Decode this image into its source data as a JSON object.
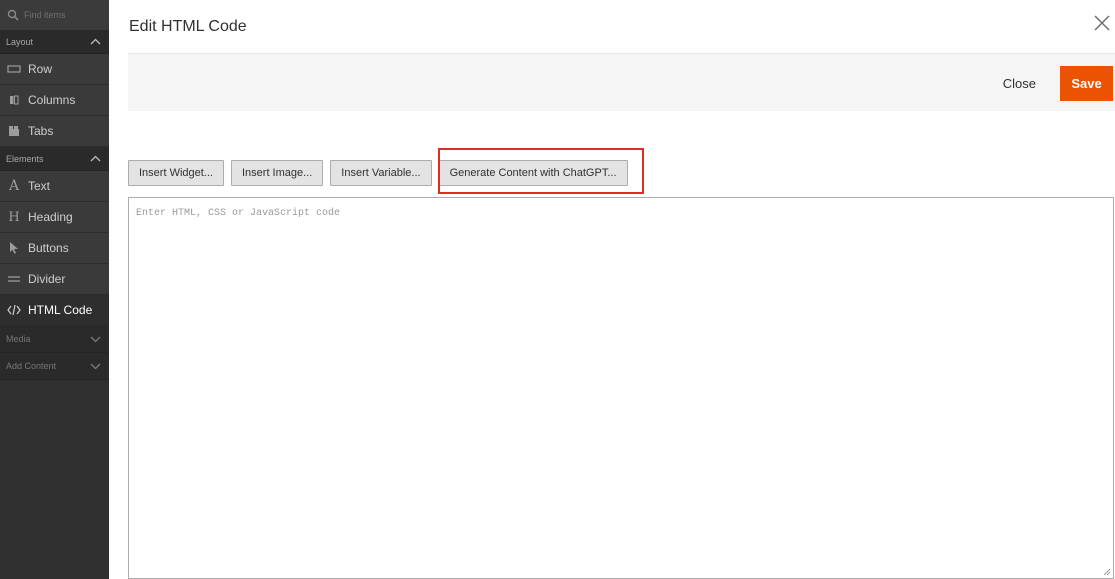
{
  "sidebar": {
    "search_placeholder": "Find items",
    "groups": {
      "layout": "Layout",
      "elements": "Elements",
      "media": "Media",
      "add_content": "Add Content"
    },
    "layout_items": [
      "Row",
      "Columns",
      "Tabs"
    ],
    "element_items": [
      "Text",
      "Heading",
      "Buttons",
      "Divider",
      "HTML Code"
    ]
  },
  "modal": {
    "title": "Edit HTML Code",
    "close_label": "Close",
    "save_label": "Save",
    "toolbar": {
      "insert_widget": "Insert Widget...",
      "insert_image": "Insert Image...",
      "insert_variable": "Insert Variable...",
      "generate_chatgpt": "Generate Content with ChatGPT..."
    },
    "editor_placeholder": "Enter HTML, CSS or JavaScript code"
  },
  "colors": {
    "accent": "#eb5202",
    "highlight": "#e02b27",
    "sidebar_bg": "#303030"
  },
  "icons": [
    "search-icon",
    "chevron-up-icon",
    "chevron-down-icon",
    "row-icon",
    "columns-icon",
    "tabs-icon",
    "text-icon",
    "heading-icon",
    "buttons-icon",
    "divider-icon",
    "html-code-icon",
    "close-icon"
  ]
}
